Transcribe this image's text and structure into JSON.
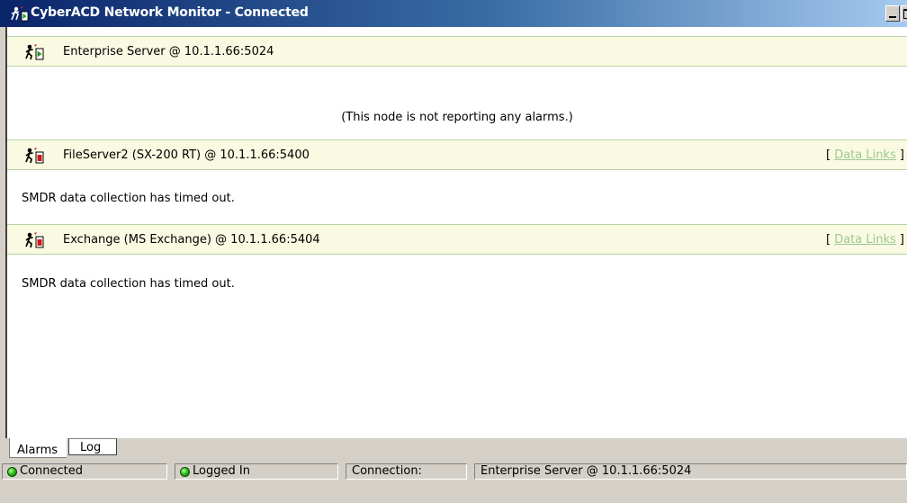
{
  "window": {
    "title": "CyberACD Network Monitor - Connected"
  },
  "nodes": [
    {
      "title": "Enterprise Server @ 10.1.1.66:5024",
      "icon": "runner-green-icon",
      "data_links": null,
      "message": "(This node is not reporting any alarms.)"
    },
    {
      "title": "FileServer2 (SX-200 RT) @ 10.1.1.66:5400",
      "icon": "runner-red-icon",
      "data_links": {
        "open": "[",
        "label": "Data Links",
        "close": "]"
      },
      "message": "SMDR data collection has timed out."
    },
    {
      "title": "Exchange (MS Exchange) @ 10.1.1.66:5404",
      "icon": "runner-red-icon",
      "data_links": {
        "open": "[",
        "label": "Data Links",
        "close": "]"
      },
      "message": "SMDR data collection has timed out."
    }
  ],
  "tabs": [
    {
      "label": "Alarms",
      "active": true
    },
    {
      "label": "Log",
      "active": false
    }
  ],
  "status": {
    "connected": "Connected",
    "logged_in": "Logged In",
    "connection_label": "Connection:",
    "connection_value": "Enterprise Server @ 10.1.1.66:5024"
  },
  "colors": {
    "header_bg": "#fafae2",
    "header_border": "#b6d3a4",
    "link": "#9cc890",
    "led_on": "#2fbe1e"
  }
}
